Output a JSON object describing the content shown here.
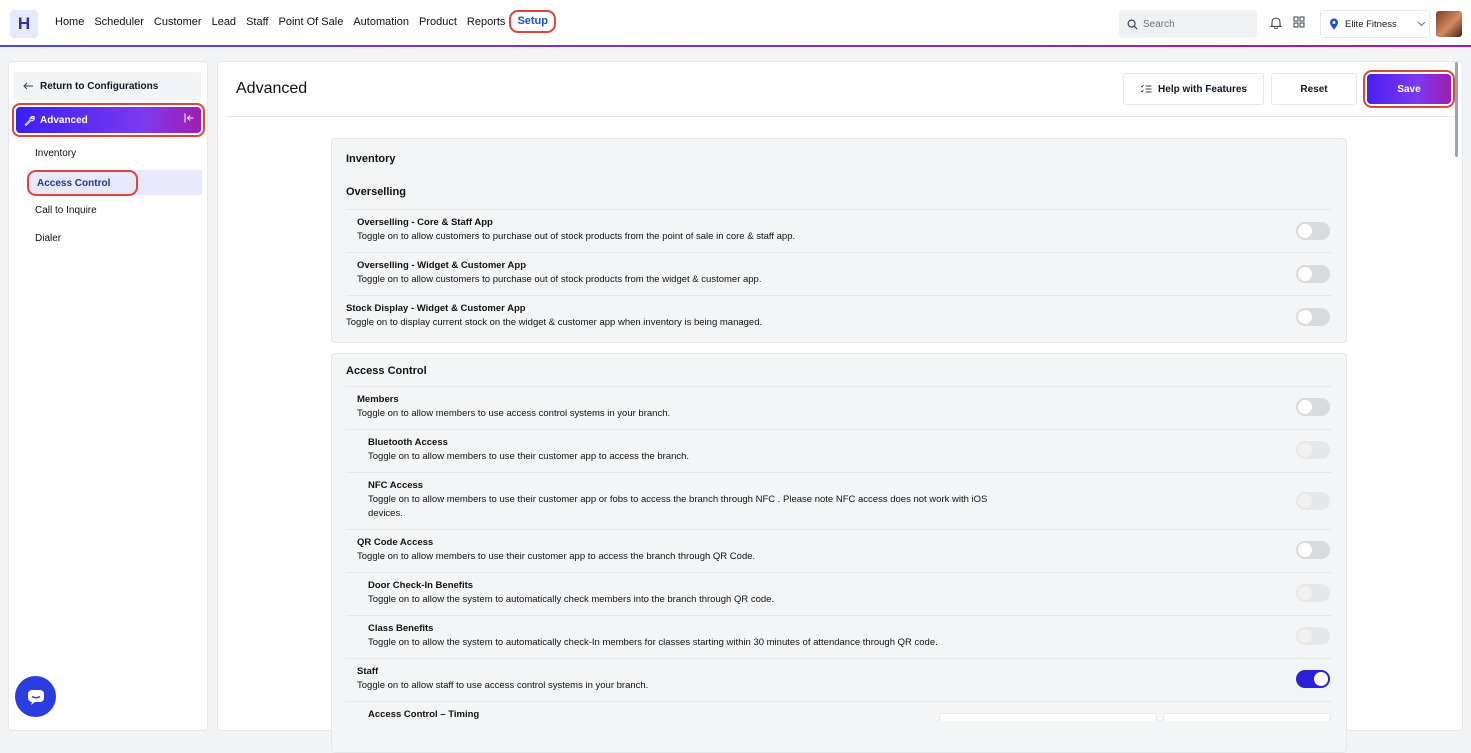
{
  "topbar": {
    "logo": "H",
    "nav": [
      "Home",
      "Scheduler",
      "Customer",
      "Lead",
      "Staff",
      "Point Of Sale",
      "Automation",
      "Product",
      "Reports",
      "Setup"
    ],
    "search_placeholder": "Search",
    "branch": "Elite Fitness",
    "bell_icon": "bell-icon",
    "grid_icon": "apps-grid-icon"
  },
  "sidebar": {
    "return_label": "Return to Configurations",
    "section_label": "Advanced",
    "items": [
      "Inventory",
      "Access Control",
      "Call to Inquire",
      "Dialer"
    ]
  },
  "main": {
    "title": "Advanced",
    "help_label": "Help with Features",
    "reset_label": "Reset",
    "save_label": "Save",
    "inventory": {
      "heading": "Inventory",
      "subheading": "Overselling",
      "rows": [
        {
          "title": "Overselling - Core & Staff App",
          "desc": "Toggle on to allow customers to purchase out of stock products from the point of sale in core & staff app.",
          "state": "off"
        },
        {
          "title": "Overselling - Widget & Customer App",
          "desc": "Toggle on to allow customers to purchase out of stock products from the widget & customer app.",
          "state": "off"
        },
        {
          "title": "Stock Display - Widget & Customer App",
          "desc": "Toggle on to display current stock on the widget & customer app when inventory is being managed.",
          "state": "off"
        }
      ]
    },
    "access_control": {
      "heading": "Access Control",
      "rows": [
        {
          "title": "Members",
          "desc": "Toggle on to allow members to use access control systems in your branch.",
          "state": "off"
        },
        {
          "title": "Bluetooth Access",
          "desc": "Toggle on to allow members to use their customer app to access the branch.",
          "state": "disabled"
        },
        {
          "title": "NFC Access",
          "desc": "Toggle on to allow members to use their customer app or fobs to access the branch through NFC . Please note NFC access does not work with iOS devices.",
          "state": "disabled"
        },
        {
          "title": "QR Code Access",
          "desc": "Toggle on to allow members to use their customer app to access the branch through QR Code.",
          "state": "off"
        },
        {
          "title": "Door Check-In Benefits",
          "desc": "Toggle on to allow the system to automatically check members into the branch through QR code.",
          "state": "disabled"
        },
        {
          "title": "Class Benefits",
          "desc": "Toggle on to allow the system to automatically check-In members for classes starting within 30 minutes of attendance through QR code.",
          "state": "disabled"
        },
        {
          "title": "Staff",
          "desc": "Toggle on to allow staff to use access control systems in your branch.",
          "state": "on"
        },
        {
          "title": "Access Control – Timing",
          "desc": "",
          "state": "none"
        }
      ]
    }
  }
}
